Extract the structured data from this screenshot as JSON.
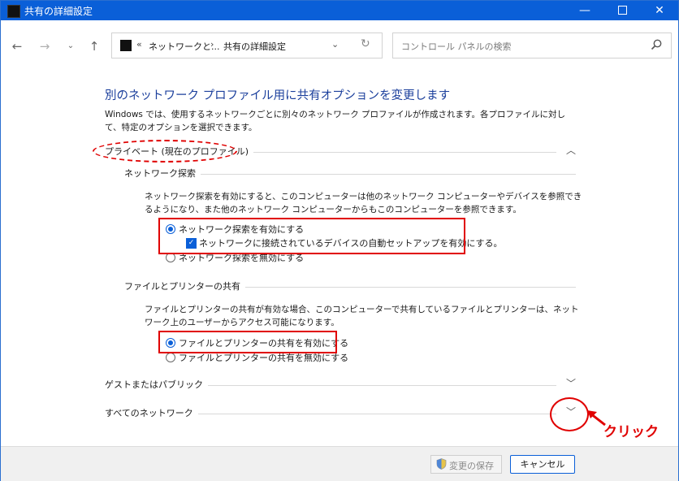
{
  "window": {
    "title": "共有の詳細設定",
    "controls": {
      "minimize": "—",
      "close": "✕"
    }
  },
  "nav": {
    "back": "←",
    "forward": "→",
    "recent": "⌄",
    "up": "↑",
    "address": {
      "chevron": "«",
      "crumb1": "ネットワークと...",
      "separator": "›",
      "crumb2": "共有の詳細設定",
      "dropdown": "⌄",
      "refresh": "↻"
    },
    "search": {
      "placeholder": "コントロール パネルの検索"
    }
  },
  "main": {
    "heading": "別のネットワーク プロファイル用に共有オプションを変更します",
    "description": "Windows では、使用するネットワークごとに別々のネットワーク プロファイルが作成されます。各プロファイルに対して、特定のオプションを選択できます。",
    "private": {
      "label": "プライベート (現在のプロファイル)",
      "chevron": "︿",
      "discovery": {
        "label": "ネットワーク探索",
        "text": "ネットワーク探索を有効にすると、このコンピューターは他のネットワーク コンピューターやデバイスを参照できるようになり、また他のネットワーク コンピューターからもこのコンピューターを参照できます。",
        "opt_on": "ネットワーク探索を有効にする",
        "auto_setup": "ネットワークに接続されているデバイスの自動セットアップを有効にする。",
        "check_mark": "✓",
        "opt_off": "ネットワーク探索を無効にする"
      },
      "sharing": {
        "label": "ファイルとプリンターの共有",
        "text": "ファイルとプリンターの共有が有効な場合、このコンピューターで共有しているファイルとプリンターは、ネットワーク上のユーザーからアクセス可能になります。",
        "opt_on": "ファイルとプリンターの共有を有効にする",
        "opt_off": "ファイルとプリンターの共有を無効にする"
      }
    },
    "guest": {
      "label": "ゲストまたはパブリック",
      "chevron": "﹀"
    },
    "all_networks": {
      "label": "すべてのネットワーク",
      "chevron": "﹀"
    }
  },
  "annotation": {
    "text": "クリック",
    "color": "#e00000"
  },
  "footer": {
    "save_label": "変更の保存",
    "cancel_label": "キャンセル"
  },
  "colors": {
    "titlebar": "#0a5fd8",
    "heading": "#1b3f9c",
    "accent": "#0a5fd8",
    "highlight": "#e00000"
  }
}
